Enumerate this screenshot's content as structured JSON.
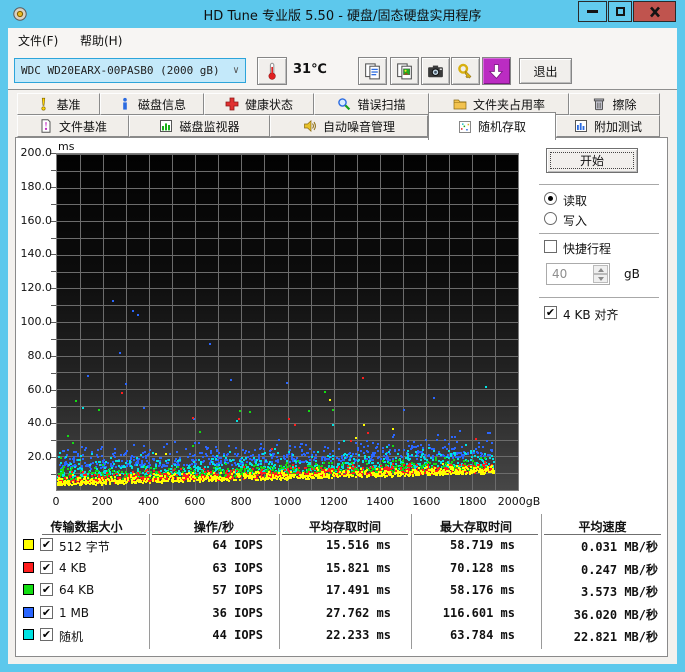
{
  "window": {
    "title": "HD Tune 专业版 5.50 - 硬盘/固态硬盘实用程序",
    "controls": [
      "minimize",
      "maximize",
      "close"
    ]
  },
  "menu": {
    "file": "文件(F)",
    "help": "帮助(H)"
  },
  "toolbar": {
    "drive": "WDC WD20EARX-00PASB0 (2000 gB)",
    "temperature": "31℃",
    "exit": "退出",
    "icon_buttons": [
      "copy-text",
      "copy-image",
      "screenshot",
      "options",
      "save-results"
    ]
  },
  "tabs": {
    "row1": [
      {
        "id": "benchmark",
        "label": "基准",
        "icon": "exclaim",
        "w": 83
      },
      {
        "id": "disk-info",
        "label": "磁盘信息",
        "icon": "info",
        "w": 104
      },
      {
        "id": "health-status",
        "label": "健康状态",
        "icon": "health",
        "w": 110
      },
      {
        "id": "error-scan",
        "label": "错误扫描",
        "icon": "scan",
        "w": 115
      },
      {
        "id": "folder-usage",
        "label": "文件夹占用率",
        "icon": "folder",
        "w": 140
      },
      {
        "id": "erase",
        "label": "擦除",
        "icon": "erase",
        "w": 91
      }
    ],
    "row2": [
      {
        "id": "file-benchmark",
        "label": "文件基准",
        "icon": "file-bench",
        "w": 112
      },
      {
        "id": "disk-monitor",
        "label": "磁盘监视器",
        "icon": "monitor",
        "w": 141
      },
      {
        "id": "auto-noise-management",
        "label": "自动噪音管理",
        "icon": "aam",
        "w": 158
      },
      {
        "id": "random-access",
        "label": "随机存取",
        "icon": "random",
        "w": 128,
        "active": true
      },
      {
        "id": "extra-tests",
        "label": "附加测试",
        "icon": "extra",
        "w": 104
      }
    ]
  },
  "controls": {
    "start": "开始",
    "mode": [
      {
        "label": "读取",
        "selected": true
      },
      {
        "label": "写入",
        "selected": false
      }
    ],
    "short_stroke": {
      "label": "快捷行程",
      "checked": false,
      "value": "40",
      "unit": "gB"
    },
    "align_4kb": {
      "label": "4 KB 对齐",
      "checked": true
    }
  },
  "chart_data": {
    "type": "scatter",
    "y_unit_label": "ms",
    "xlim": [
      0,
      2000
    ],
    "ylim": [
      0,
      200
    ],
    "x_grid_step": 100,
    "y_grid_step": 10,
    "x_ticks": [
      {
        "v": 0,
        "label": "0"
      },
      {
        "v": 200,
        "label": "200"
      },
      {
        "v": 400,
        "label": "400"
      },
      {
        "v": 600,
        "label": "600"
      },
      {
        "v": 800,
        "label": "800"
      },
      {
        "v": 1000,
        "label": "1000"
      },
      {
        "v": 1200,
        "label": "1200"
      },
      {
        "v": 1400,
        "label": "1400"
      },
      {
        "v": 1600,
        "label": "1600"
      },
      {
        "v": 1800,
        "label": "1800"
      },
      {
        "v": 2000,
        "label": "2000gB"
      }
    ],
    "y_ticks": [
      {
        "v": 20,
        "label": "20.0"
      },
      {
        "v": 40,
        "label": "40.0"
      },
      {
        "v": 60,
        "label": "60.0"
      },
      {
        "v": 80,
        "label": "80.0"
      },
      {
        "v": 100,
        "label": "100.0"
      },
      {
        "v": 120,
        "label": "120.0"
      },
      {
        "v": 140,
        "label": "140.0"
      },
      {
        "v": 160,
        "label": "160.0"
      },
      {
        "v": 180,
        "label": "180.0"
      },
      {
        "v": 200,
        "label": "200.0"
      }
    ],
    "data_extent_gb": 1895,
    "series": [
      {
        "name": "512 字节",
        "color": "#ffff00",
        "points": 820,
        "base_start_ms": 3.5,
        "base_end_ms": 11,
        "spread_ms": 6,
        "outlier_rate": 0.01,
        "outlier_max_ms": 58.7
      },
      {
        "name": "4 KB",
        "color": "#ff1e1e",
        "points": 800,
        "base_start_ms": 4.5,
        "base_end_ms": 12,
        "spread_ms": 7,
        "outlier_rate": 0.012,
        "outlier_max_ms": 70.1
      },
      {
        "name": "64 KB",
        "color": "#12dd12",
        "points": 760,
        "base_start_ms": 5.5,
        "base_end_ms": 13,
        "spread_ms": 9,
        "outlier_rate": 0.015,
        "outlier_max_ms": 58.2
      },
      {
        "name": "1 MB",
        "color": "#2a66ff",
        "points": 600,
        "base_start_ms": 13,
        "base_end_ms": 21,
        "spread_ms": 16,
        "outlier_rate": 0.02,
        "outlier_max_ms": 116.6
      },
      {
        "name": "随机",
        "color": "#00e2e2",
        "points": 620,
        "base_start_ms": 8,
        "base_end_ms": 15,
        "spread_ms": 15,
        "outlier_rate": 0.015,
        "outlier_max_ms": 63.8
      }
    ],
    "draw_order": [
      3,
      4,
      2,
      1,
      0
    ],
    "grid": true,
    "legend_position": "table-below"
  },
  "table": {
    "headers": [
      "传输数据大小",
      "操作/秒",
      "平均存取时间",
      "最大存取时间",
      "平均速度"
    ],
    "rows": [
      {
        "color": "#ffff00",
        "checked": true,
        "label": "512 字节",
        "ops": "64 IOPS",
        "avg_access": "15.516 ms",
        "max_access": "58.719 ms",
        "avg_speed": "0.031 MB/秒"
      },
      {
        "color": "#ff1e1e",
        "checked": true,
        "label": "4 KB",
        "ops": "63 IOPS",
        "avg_access": "15.821 ms",
        "max_access": "70.128 ms",
        "avg_speed": "0.247 MB/秒"
      },
      {
        "color": "#12dd12",
        "checked": true,
        "label": "64 KB",
        "ops": "57 IOPS",
        "avg_access": "17.491 ms",
        "max_access": "58.176 ms",
        "avg_speed": "3.573 MB/秒"
      },
      {
        "color": "#2a66ff",
        "checked": true,
        "label": "1 MB",
        "ops": "36 IOPS",
        "avg_access": "27.762 ms",
        "max_access": "116.601 ms",
        "avg_speed": "36.020 MB/秒"
      },
      {
        "color": "#00e2e2",
        "checked": true,
        "label": "随机",
        "ops": "44 IOPS",
        "avg_access": "22.233 ms",
        "max_access": "63.784 ms",
        "avg_speed": "22.821 MB/秒"
      }
    ]
  }
}
